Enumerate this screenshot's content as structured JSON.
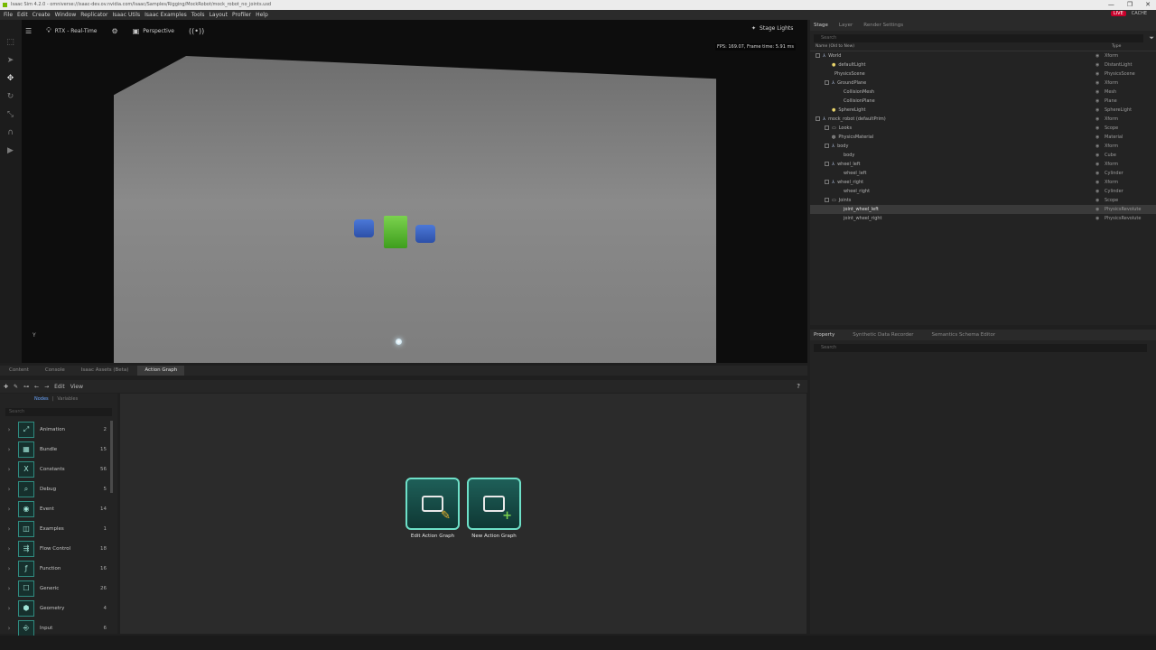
{
  "window": {
    "title": "Isaac Sim 4.2.0 - omniverse://isaac-dev.ov.nvidia.com/Isaac/Samples/Rigging/MockRobot/mock_robot_no_joints.usd",
    "controls": [
      "—",
      "❐",
      "✕"
    ]
  },
  "menu": {
    "items": [
      "File",
      "Edit",
      "Create",
      "Window",
      "Replicator",
      "Isaac Utils",
      "Isaac Examples",
      "Tools",
      "Layout",
      "Profiler",
      "Help"
    ],
    "live_label": "LIVE",
    "cache_label": "CACHE"
  },
  "viewport": {
    "render_mode": "RTX - Real-Time",
    "camera": "Perspective",
    "stage_lights": "Stage Lights",
    "fps_text": "FPS: 169.07, Frame time: 5.91 ms",
    "axis_label": "Y"
  },
  "stage": {
    "tabs": [
      "Stage",
      "Layer",
      "Render Settings"
    ],
    "search_placeholder": "Search",
    "col_name": "Name (Old to New)",
    "col_type": "Type",
    "rows": [
      {
        "name": "World",
        "type": "Xform",
        "depth": 0,
        "expander": true,
        "icon": "xform"
      },
      {
        "name": "defaultLight",
        "type": "DistantLight",
        "depth": 1,
        "expander": false,
        "icon": "light"
      },
      {
        "name": "PhysicsScene",
        "type": "PhysicsScene",
        "depth": 1,
        "expander": false,
        "icon": "none"
      },
      {
        "name": "GroundPlane",
        "type": "Xform",
        "depth": 1,
        "expander": true,
        "icon": "xform"
      },
      {
        "name": "CollisionMesh",
        "type": "Mesh",
        "depth": 2,
        "expander": false,
        "icon": "none"
      },
      {
        "name": "CollisionPlane",
        "type": "Plane",
        "depth": 2,
        "expander": false,
        "icon": "none"
      },
      {
        "name": "SphereLight",
        "type": "SphereLight",
        "depth": 1,
        "expander": false,
        "icon": "light"
      },
      {
        "name": "mock_robot (defaultPrim)",
        "type": "Xform",
        "depth": 0,
        "expander": true,
        "icon": "xform"
      },
      {
        "name": "Looks",
        "type": "Scope",
        "depth": 1,
        "expander": true,
        "icon": "folder"
      },
      {
        "name": "PhysicsMaterial",
        "type": "Material",
        "depth": 1,
        "expander": false,
        "icon": "material"
      },
      {
        "name": "body",
        "type": "Xform",
        "depth": 1,
        "expander": true,
        "icon": "xform"
      },
      {
        "name": "body",
        "type": "Cube",
        "depth": 2,
        "expander": false,
        "icon": "none"
      },
      {
        "name": "wheel_left",
        "type": "Xform",
        "depth": 1,
        "expander": true,
        "icon": "xform"
      },
      {
        "name": "wheel_left",
        "type": "Cylinder",
        "depth": 2,
        "expander": false,
        "icon": "none"
      },
      {
        "name": "wheel_right",
        "type": "Xform",
        "depth": 1,
        "expander": true,
        "icon": "xform"
      },
      {
        "name": "wheel_right",
        "type": "Cylinder",
        "depth": 2,
        "expander": false,
        "icon": "none"
      },
      {
        "name": "Joints",
        "type": "Scope",
        "depth": 1,
        "expander": true,
        "icon": "folder"
      },
      {
        "name": "joint_wheel_left",
        "type": "PhysicsRevolute",
        "depth": 2,
        "expander": false,
        "icon": "none",
        "selected": true
      },
      {
        "name": "joint_wheel_right",
        "type": "PhysicsRevolute",
        "depth": 2,
        "expander": false,
        "icon": "none"
      }
    ]
  },
  "property": {
    "tabs": [
      "Property",
      "Synthetic Data Recorder",
      "Semantics Schema Editor"
    ],
    "search_placeholder": "Search"
  },
  "bottom_tabs": [
    "Content",
    "Console",
    "Isaac Assets (Beta)",
    "Action Graph"
  ],
  "action_graph": {
    "menu": [
      "Edit",
      "View"
    ],
    "help": "?",
    "subtabs": [
      "Nodes",
      "Variables"
    ],
    "search_placeholder": "Search",
    "categories": [
      {
        "label": "Animation",
        "count": "2",
        "glyph": "⤢"
      },
      {
        "label": "Bundle",
        "count": "15",
        "glyph": "▦"
      },
      {
        "label": "Constants",
        "count": "56",
        "glyph": "X"
      },
      {
        "label": "Debug",
        "count": "5",
        "glyph": "⌕"
      },
      {
        "label": "Event",
        "count": "14",
        "glyph": "◉"
      },
      {
        "label": "Examples",
        "count": "1",
        "glyph": "◫"
      },
      {
        "label": "Flow Control",
        "count": "18",
        "glyph": "⇶"
      },
      {
        "label": "Function",
        "count": "16",
        "glyph": "ƒ"
      },
      {
        "label": "Generic",
        "count": "26",
        "glyph": "☐"
      },
      {
        "label": "Geometry",
        "count": "4",
        "glyph": "⬢"
      },
      {
        "label": "Input",
        "count": "6",
        "glyph": "⎆"
      }
    ],
    "edit_graph_label": "Edit Action Graph",
    "new_graph_label": "New Action Graph"
  },
  "colors": {
    "accent_teal": "#6ee0c8",
    "robot_body": "#5cbf30",
    "robot_wheels": "#3a62c4",
    "live_red": "#c8002a"
  }
}
